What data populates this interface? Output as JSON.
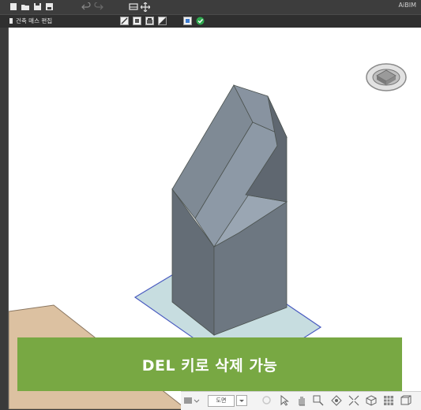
{
  "app": {
    "brand": "AiBIM"
  },
  "toolbar": {
    "context_label": "건축 매스 편집"
  },
  "overlay": {
    "banner_text": "DEL 키로 삭제 가능"
  },
  "bottom_toolbar": {
    "view_select": "도면"
  },
  "colors": {
    "topbar": "#3d3d3d",
    "viewport": "#ffffff",
    "mass_front": "#6d7781",
    "mass_side": "#8d99a6",
    "base_plane": "#c7dde0",
    "ground": "#dcc1a1",
    "banner": "#78a843"
  }
}
